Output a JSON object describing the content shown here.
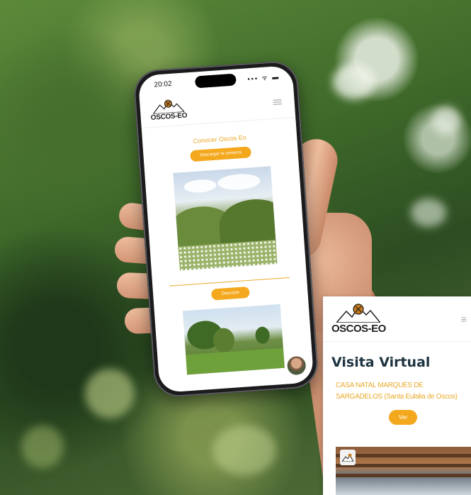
{
  "phone": {
    "status_time": "20:02",
    "status_icons": "▪▪▪ ᯤ ▬",
    "logo_text": "OSCOS-EO",
    "section_title": "Conocer Oscos Eo",
    "primary_button": "Descargar la comarca",
    "secondary_button": "Descubrir"
  },
  "inset": {
    "logo_text": "OSCOS-EO",
    "menu_glyph": "≡",
    "title": "Visita Virtual",
    "subtitle": "CASA NATAL MARQUÉS DE SARGADELOS (Santa Eulalia de Oscos)",
    "button_label": "Ver"
  },
  "colors": {
    "accent": "#f4a81d",
    "title_dark": "#1e3340"
  }
}
